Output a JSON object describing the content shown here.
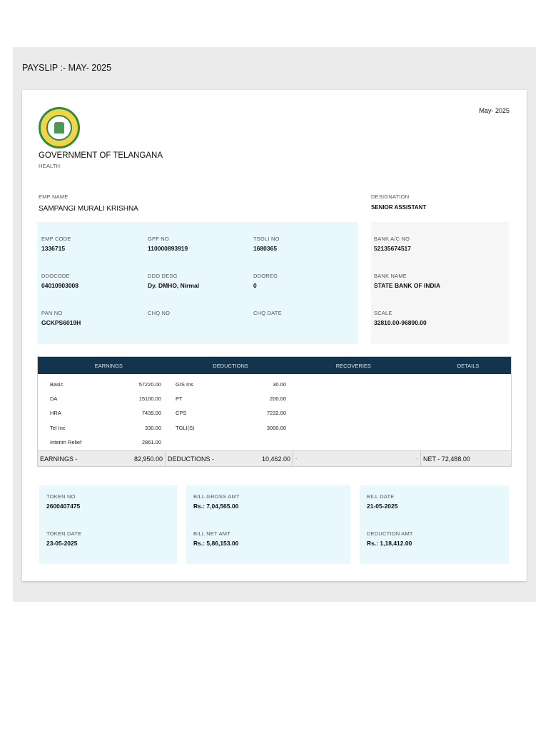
{
  "page_title": "PAYSLIP :- MAY- 2025",
  "month": "May- 2025",
  "org": {
    "name": "GOVERNMENT OF TELANGANA",
    "dept": "HEALTH",
    "logo_text": "GOVERNMENT OF TELANGANA"
  },
  "employee": {
    "name_label": "EMP NAME",
    "name": "SAMPANGI MURALI KRISHNA",
    "desg_label": "DESIGNATION",
    "desg": "SENIOR ASSISTANT"
  },
  "info": [
    {
      "label": "EMP CODE",
      "value": "1336715"
    },
    {
      "label": "GPF NO",
      "value": "110000893919"
    },
    {
      "label": "TSGLI NO",
      "value": "1680365"
    },
    {
      "label": "DDOCODE",
      "value": "04010903008"
    },
    {
      "label": "DDO DESG",
      "value": "Dy. DMHO, Nirmal"
    },
    {
      "label": "DDOREG",
      "value": "0"
    },
    {
      "label": "PAN NO",
      "value": "GCKPS6019H"
    },
    {
      "label": "CHQ NO",
      "value": ""
    },
    {
      "label": "CHQ DATE",
      "value": ""
    }
  ],
  "bank": [
    {
      "label": "BANK A/C NO",
      "value": "52135674517"
    },
    {
      "label": "BANK NAME",
      "value": "STATE BANK OF INDIA"
    },
    {
      "label": "SCALE",
      "value": "32810.00-96890.00"
    }
  ],
  "table": {
    "headers": [
      "EARNINGS",
      "DEDUCTIONS",
      "RECOVERIES",
      "DETAILS"
    ],
    "rows": [
      {
        "e": "Basic",
        "ev": "57220.00",
        "d": "GIS Ins",
        "dv": "30.00"
      },
      {
        "e": "DA",
        "ev": "15100.00",
        "d": "PT",
        "dv": "200.00"
      },
      {
        "e": "HRA",
        "ev": "7439.00",
        "d": "CPS",
        "dv": "7232.00"
      },
      {
        "e": "Tel Inc",
        "ev": "330.00",
        "d": "TGLI(S)",
        "dv": "3000.00"
      },
      {
        "e": "Interim Relief",
        "ev": "2861.00",
        "d": "",
        "dv": ""
      }
    ],
    "footer": {
      "earn_label": "EARNINGS -",
      "earn": "82,950.00",
      "ded_label": "DEDUCTIONS -",
      "ded": "10,462.00",
      "rec_label": "-",
      "rec": "-",
      "net": "NET - 72,488.00"
    }
  },
  "bill": [
    {
      "label": "TOKEN NO",
      "value": "2600407475"
    },
    {
      "label": "TOKEN DATE",
      "value": "23-05-2025"
    },
    {
      "label": "BILL GROSS AMT",
      "value": "Rs.: 7,04,565.00"
    },
    {
      "label": "BILL NET AMT",
      "value": "Rs.: 5,86,153.00"
    },
    {
      "label": "BILL DATE",
      "value": "21-05-2025"
    },
    {
      "label": "DEDUCTION AMT",
      "value": "Rs.: 1,18,412.00"
    }
  ]
}
